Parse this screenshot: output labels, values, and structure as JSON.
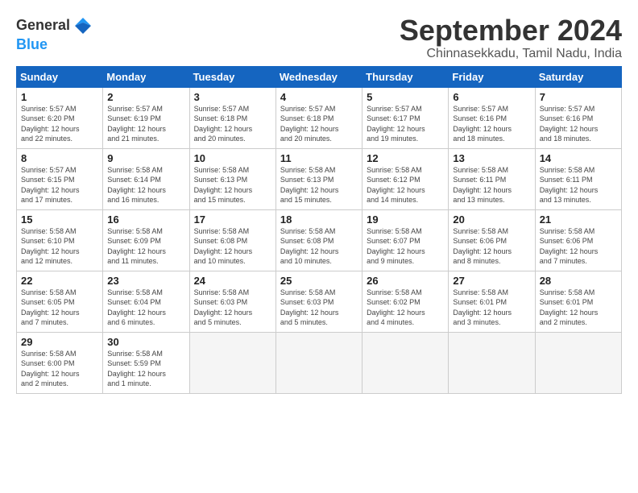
{
  "logo": {
    "line1": "General",
    "line2": "Blue"
  },
  "title": "September 2024",
  "location": "Chinnasekkadu, Tamil Nadu, India",
  "days_of_week": [
    "Sunday",
    "Monday",
    "Tuesday",
    "Wednesday",
    "Thursday",
    "Friday",
    "Saturday"
  ],
  "weeks": [
    [
      {
        "day": 1,
        "sunrise": "5:57 AM",
        "sunset": "6:20 PM",
        "daylight": "12 hours and 22 minutes."
      },
      {
        "day": 2,
        "sunrise": "5:57 AM",
        "sunset": "6:19 PM",
        "daylight": "12 hours and 21 minutes."
      },
      {
        "day": 3,
        "sunrise": "5:57 AM",
        "sunset": "6:18 PM",
        "daylight": "12 hours and 20 minutes."
      },
      {
        "day": 4,
        "sunrise": "5:57 AM",
        "sunset": "6:18 PM",
        "daylight": "12 hours and 20 minutes."
      },
      {
        "day": 5,
        "sunrise": "5:57 AM",
        "sunset": "6:17 PM",
        "daylight": "12 hours and 19 minutes."
      },
      {
        "day": 6,
        "sunrise": "5:57 AM",
        "sunset": "6:16 PM",
        "daylight": "12 hours and 18 minutes."
      },
      {
        "day": 7,
        "sunrise": "5:57 AM",
        "sunset": "6:16 PM",
        "daylight": "12 hours and 18 minutes."
      }
    ],
    [
      {
        "day": 8,
        "sunrise": "5:57 AM",
        "sunset": "6:15 PM",
        "daylight": "12 hours and 17 minutes."
      },
      {
        "day": 9,
        "sunrise": "5:58 AM",
        "sunset": "6:14 PM",
        "daylight": "12 hours and 16 minutes."
      },
      {
        "day": 10,
        "sunrise": "5:58 AM",
        "sunset": "6:13 PM",
        "daylight": "12 hours and 15 minutes."
      },
      {
        "day": 11,
        "sunrise": "5:58 AM",
        "sunset": "6:13 PM",
        "daylight": "12 hours and 15 minutes."
      },
      {
        "day": 12,
        "sunrise": "5:58 AM",
        "sunset": "6:12 PM",
        "daylight": "12 hours and 14 minutes."
      },
      {
        "day": 13,
        "sunrise": "5:58 AM",
        "sunset": "6:11 PM",
        "daylight": "12 hours and 13 minutes."
      },
      {
        "day": 14,
        "sunrise": "5:58 AM",
        "sunset": "6:11 PM",
        "daylight": "12 hours and 13 minutes."
      }
    ],
    [
      {
        "day": 15,
        "sunrise": "5:58 AM",
        "sunset": "6:10 PM",
        "daylight": "12 hours and 12 minutes."
      },
      {
        "day": 16,
        "sunrise": "5:58 AM",
        "sunset": "6:09 PM",
        "daylight": "12 hours and 11 minutes."
      },
      {
        "day": 17,
        "sunrise": "5:58 AM",
        "sunset": "6:08 PM",
        "daylight": "12 hours and 10 minutes."
      },
      {
        "day": 18,
        "sunrise": "5:58 AM",
        "sunset": "6:08 PM",
        "daylight": "12 hours and 10 minutes."
      },
      {
        "day": 19,
        "sunrise": "5:58 AM",
        "sunset": "6:07 PM",
        "daylight": "12 hours and 9 minutes."
      },
      {
        "day": 20,
        "sunrise": "5:58 AM",
        "sunset": "6:06 PM",
        "daylight": "12 hours and 8 minutes."
      },
      {
        "day": 21,
        "sunrise": "5:58 AM",
        "sunset": "6:06 PM",
        "daylight": "12 hours and 7 minutes."
      }
    ],
    [
      {
        "day": 22,
        "sunrise": "5:58 AM",
        "sunset": "6:05 PM",
        "daylight": "12 hours and 7 minutes."
      },
      {
        "day": 23,
        "sunrise": "5:58 AM",
        "sunset": "6:04 PM",
        "daylight": "12 hours and 6 minutes."
      },
      {
        "day": 24,
        "sunrise": "5:58 AM",
        "sunset": "6:03 PM",
        "daylight": "12 hours and 5 minutes."
      },
      {
        "day": 25,
        "sunrise": "5:58 AM",
        "sunset": "6:03 PM",
        "daylight": "12 hours and 5 minutes."
      },
      {
        "day": 26,
        "sunrise": "5:58 AM",
        "sunset": "6:02 PM",
        "daylight": "12 hours and 4 minutes."
      },
      {
        "day": 27,
        "sunrise": "5:58 AM",
        "sunset": "6:01 PM",
        "daylight": "12 hours and 3 minutes."
      },
      {
        "day": 28,
        "sunrise": "5:58 AM",
        "sunset": "6:01 PM",
        "daylight": "12 hours and 2 minutes."
      }
    ],
    [
      {
        "day": 29,
        "sunrise": "5:58 AM",
        "sunset": "6:00 PM",
        "daylight": "12 hours and 2 minutes."
      },
      {
        "day": 30,
        "sunrise": "5:58 AM",
        "sunset": "5:59 PM",
        "daylight": "12 hours and 1 minute."
      },
      null,
      null,
      null,
      null,
      null
    ]
  ]
}
